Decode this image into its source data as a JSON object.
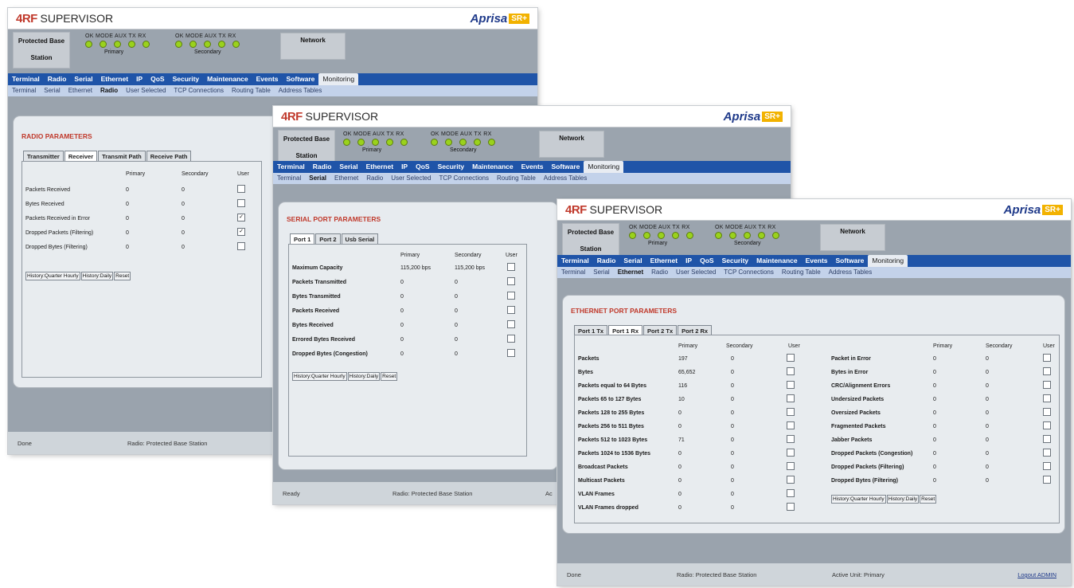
{
  "header": {
    "brand_logo": "4RF",
    "brand_product": "SUPERVISOR",
    "aprisa_text": "Aprisa",
    "aprisa_tag": "SR+"
  },
  "status_panel": {
    "station_line1": "Protected Base",
    "station_line2": "Station",
    "led_labels": "OK  MODE  AUX  TX  RX",
    "primary_label": "Primary",
    "secondary_label": "Secondary",
    "network_label": "Network",
    "led_color": "#9ad21c"
  },
  "menu": [
    "Terminal",
    "Radio",
    "Serial",
    "Ethernet",
    "IP",
    "QoS",
    "Security",
    "Maintenance",
    "Events",
    "Software",
    "Monitoring"
  ],
  "submenu": [
    "Terminal",
    "Serial",
    "Ethernet",
    "Radio",
    "User Selected",
    "TCP Connections",
    "Routing Table",
    "Address Tables"
  ],
  "win1": {
    "title": "RADIO PARAMETERS",
    "tabs": [
      "Transmitter",
      "Receiver",
      "Transmit Path",
      "Receive Path"
    ],
    "headers": [
      "Primary",
      "Secondary",
      "User"
    ],
    "rows": [
      {
        "label": "Packets Received",
        "primary": "0",
        "secondary": "0",
        "checked": ""
      },
      {
        "label": "Bytes Received",
        "primary": "0",
        "secondary": "0",
        "checked": ""
      },
      {
        "label": "Packets Received in Error",
        "primary": "0",
        "secondary": "0",
        "checked": "✓"
      },
      {
        "label": "Dropped Packets (Filtering)",
        "primary": "0",
        "secondary": "0",
        "checked": "✓"
      },
      {
        "label": "Dropped Bytes (Filtering)",
        "primary": "0",
        "secondary": "0",
        "checked": ""
      }
    ],
    "history": [
      "History:Quarter Hourly",
      "History:Daily",
      "Reset"
    ],
    "status_left": "Done",
    "status_mid": "Radio: Protected Base Station"
  },
  "win2": {
    "title": "SERIAL PORT PARAMETERS",
    "tabs": [
      "Port 1",
      "Port 2",
      "Usb Serial"
    ],
    "headers": [
      "Primary",
      "Secondary",
      "User"
    ],
    "rows": [
      {
        "label": "Maximum Capacity",
        "primary": "115,200 bps",
        "secondary": "115,200 bps"
      },
      {
        "label": "Packets Transmitted",
        "primary": "0",
        "secondary": "0"
      },
      {
        "label": "Bytes Transmitted",
        "primary": "0",
        "secondary": "0"
      },
      {
        "label": "Packets Received",
        "primary": "0",
        "secondary": "0"
      },
      {
        "label": "Bytes Received",
        "primary": "0",
        "secondary": "0"
      },
      {
        "label": "Errored Bytes Received",
        "primary": "0",
        "secondary": "0"
      },
      {
        "label": "Dropped Bytes (Congestion)",
        "primary": "0",
        "secondary": "0"
      }
    ],
    "history": [
      "History:Quarter Hourly",
      "History:Daily",
      "Reset"
    ],
    "status_left": "Ready",
    "status_mid": "Radio: Protected Base Station",
    "status_right": "Ac"
  },
  "win3": {
    "title": "ETHERNET PORT PARAMETERS",
    "tabs": [
      "Port 1 Tx",
      "Port 1 Rx",
      "Port 2 Tx",
      "Port 2 Rx"
    ],
    "headers": [
      "Primary",
      "Secondary",
      "User"
    ],
    "left_rows": [
      {
        "label": "Packets",
        "primary": "197",
        "secondary": "0"
      },
      {
        "label": "Bytes",
        "primary": "65,652",
        "secondary": "0"
      },
      {
        "label": "Packets equal to 64 Bytes",
        "primary": "116",
        "secondary": "0"
      },
      {
        "label": "Packets 65 to 127 Bytes",
        "primary": "10",
        "secondary": "0"
      },
      {
        "label": "Packets 128 to 255 Bytes",
        "primary": "0",
        "secondary": "0"
      },
      {
        "label": "Packets 256 to 511 Bytes",
        "primary": "0",
        "secondary": "0"
      },
      {
        "label": "Packets 512 to 1023 Bytes",
        "primary": "71",
        "secondary": "0"
      },
      {
        "label": "Packets 1024 to 1536 Bytes",
        "primary": "0",
        "secondary": "0"
      },
      {
        "label": "Broadcast Packets",
        "primary": "0",
        "secondary": "0"
      },
      {
        "label": "Multicast Packets",
        "primary": "0",
        "secondary": "0"
      },
      {
        "label": "VLAN Frames",
        "primary": "0",
        "secondary": "0"
      },
      {
        "label": "VLAN Frames dropped",
        "primary": "0",
        "secondary": "0"
      }
    ],
    "right_rows": [
      {
        "label": "Packet in Error",
        "primary": "0",
        "secondary": "0"
      },
      {
        "label": "Bytes in Error",
        "primary": "0",
        "secondary": "0"
      },
      {
        "label": "CRC/Alignment Errors",
        "primary": "0",
        "secondary": "0"
      },
      {
        "label": "Undersized Packets",
        "primary": "0",
        "secondary": "0"
      },
      {
        "label": "Oversized Packets",
        "primary": "0",
        "secondary": "0"
      },
      {
        "label": "Fragmented Packets",
        "primary": "0",
        "secondary": "0"
      },
      {
        "label": "Jabber Packets",
        "primary": "0",
        "secondary": "0"
      },
      {
        "label": "Dropped Packets (Congestion)",
        "primary": "0",
        "secondary": "0"
      },
      {
        "label": "Dropped Packets (Filtering)",
        "primary": "0",
        "secondary": "0"
      },
      {
        "label": "Dropped Bytes (Filtering)",
        "primary": "0",
        "secondary": "0"
      }
    ],
    "history": [
      "History:Quarter Hourly",
      "History:Daily",
      "Reset"
    ],
    "status_left": "Done",
    "status_mid": "Radio: Protected Base Station",
    "status_unit": "Active Unit: Primary",
    "status_logout": "Logout ADMIN"
  }
}
